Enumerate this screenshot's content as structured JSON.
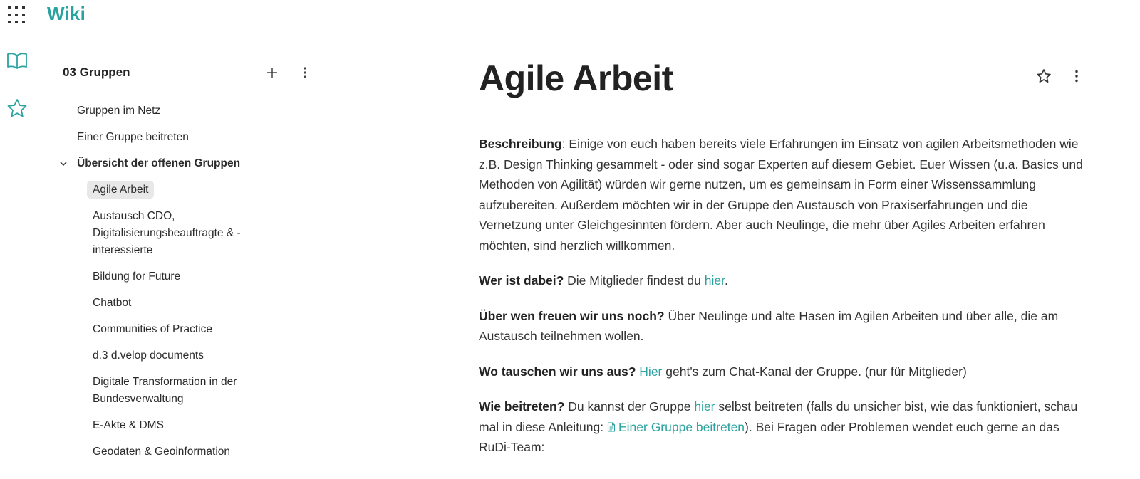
{
  "app": {
    "title": "Wiki"
  },
  "nav": {
    "title": "03 Gruppen",
    "items": [
      {
        "label": "Gruppen im Netz"
      },
      {
        "label": "Einer Gruppe beitreten"
      }
    ],
    "group": {
      "label": "Übersicht der offenen Gruppen",
      "children": [
        {
          "label": "Agile Arbeit",
          "selected": true
        },
        {
          "label": "Austausch CDO, Digitalisierungsbeauftragte & -interessierte"
        },
        {
          "label": "Bildung for Future"
        },
        {
          "label": "Chatbot"
        },
        {
          "label": "Communities of Practice"
        },
        {
          "label": "d.3 d.velop documents"
        },
        {
          "label": "Digitale Transformation in der Bundesverwaltung"
        },
        {
          "label": "E-Akte & DMS"
        },
        {
          "label": "Geodaten & Geoinformation"
        }
      ]
    }
  },
  "page": {
    "title": "Agile Arbeit",
    "p1": {
      "bold": "Beschreibung",
      "text": ": Einige von euch haben bereits viele Erfahrungen im Einsatz von agilen Arbeitsmethoden wie z.B. Design Thinking gesammelt - oder sind sogar Experten auf diesem Gebiet. Euer Wissen (u.a. Basics und Methoden von Agilität) würden wir gerne nutzen, um es gemeinsam in Form einer Wissenssammlung aufzubereiten. Außerdem möchten wir in der Gruppe den Austausch von Praxiserfahrungen und die Vernetzung unter Gleichgesinnten fördern. Aber auch Neulinge, die mehr über Agiles Arbeiten erfahren möchten, sind herzlich willkommen."
    },
    "p2": {
      "bold": "Wer ist dabei?",
      "text": " Die Mitglieder findest du ",
      "link": "hier",
      "after": "."
    },
    "p3": {
      "bold": "Über wen freuen wir uns noch?",
      "text": " Über Neulinge und alte Hasen im Agilen Arbeiten und über alle, die am Austausch teilnehmen wollen."
    },
    "p4": {
      "bold": "Wo tauschen wir uns aus?",
      "link": "Hier",
      "text": " geht's zum Chat-Kanal der Gruppe.  (nur für Mitglieder)"
    },
    "p5": {
      "bold": "Wie beitreten?",
      "text1": " Du kannst der Gruppe ",
      "link1": "hier",
      "text2": " selbst beitreten (falls du unsicher bist, wie das funktioniert, schau mal in diese Anleitung: ",
      "link2": "Einer Gruppe beitreten",
      "text3": "). Bei Fragen oder Problemen wendet euch gerne an das RuDi-Team:"
    }
  },
  "colors": {
    "accent": "#2aa3a0",
    "selected_bg": "#e8e8e8"
  },
  "icons": [
    "apps-grid-icon",
    "book-open-icon",
    "star-icon",
    "plus-icon",
    "more-vertical-icon",
    "chevron-down-icon",
    "document-icon"
  ]
}
